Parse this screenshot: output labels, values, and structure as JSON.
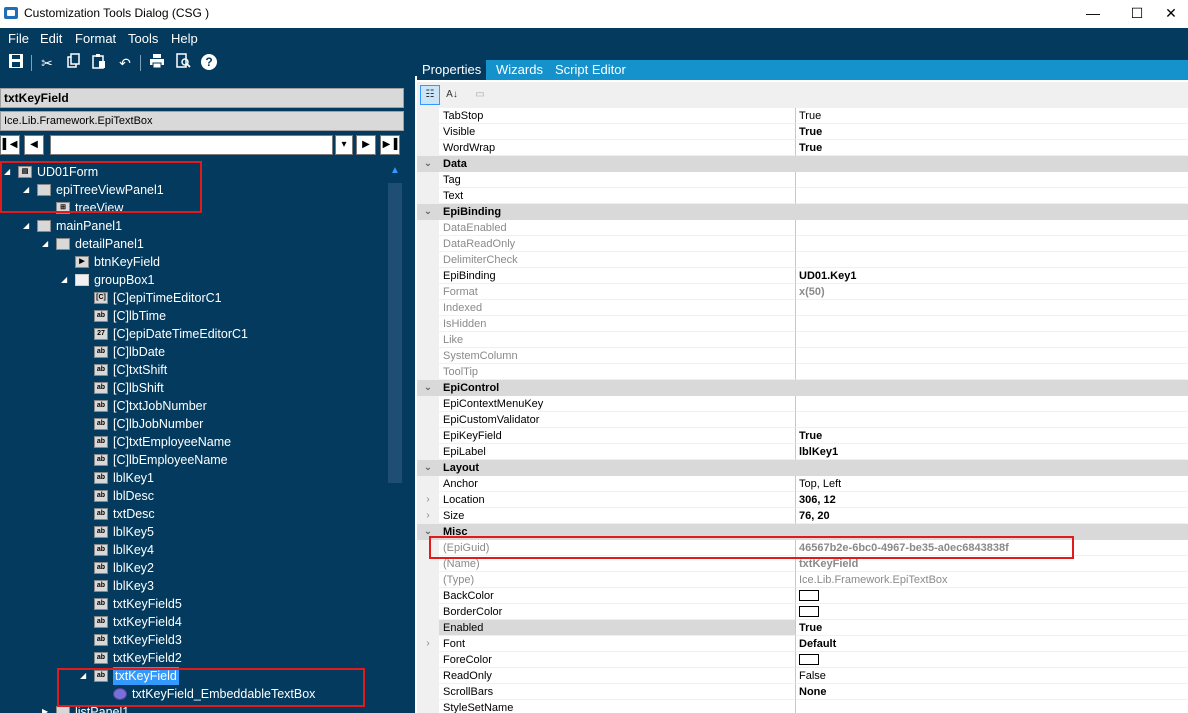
{
  "window": {
    "title": "Customization Tools Dialog  (CSG )",
    "minimize": "—",
    "maximize": "☐",
    "close": "✕"
  },
  "menu": [
    "File",
    "Edit",
    "Format",
    "Tools",
    "Help"
  ],
  "toolbar_icons": [
    "save-icon",
    "cut-icon",
    "copy-icon",
    "paste-icon",
    "undo-icon",
    "print-icon",
    "print-preview-icon",
    "help-icon"
  ],
  "left": {
    "selected_name": "txtKeyField",
    "selected_type": "Ice.Lib.Framework.EpiTextBox"
  },
  "tree": [
    {
      "label": "UD01Form",
      "level": 0,
      "expand": "◢",
      "icon": "form"
    },
    {
      "label": "epiTreeViewPanel1",
      "level": 1,
      "expand": "◢",
      "icon": "panel"
    },
    {
      "label": "treeView",
      "level": 2,
      "expand": "",
      "icon": "treeview"
    },
    {
      "label": "mainPanel1",
      "level": 1,
      "expand": "◢",
      "icon": "panel"
    },
    {
      "label": "detailPanel1",
      "level": 2,
      "expand": "◢",
      "icon": "panel"
    },
    {
      "label": "btnKeyField",
      "level": 3,
      "expand": "",
      "icon": "button"
    },
    {
      "label": "groupBox1",
      "level": 3,
      "expand": "◢",
      "icon": "folder"
    },
    {
      "label": "[C]epiTimeEditorC1",
      "level": 4,
      "expand": "",
      "icon": "time"
    },
    {
      "label": "[C]lbTime",
      "level": 4,
      "expand": "",
      "icon": "ab"
    },
    {
      "label": "[C]epiDateTimeEditorC1",
      "level": 4,
      "expand": "",
      "icon": "date"
    },
    {
      "label": "[C]lbDate",
      "level": 4,
      "expand": "",
      "icon": "ab"
    },
    {
      "label": "[C]txtShift",
      "level": 4,
      "expand": "",
      "icon": "txt"
    },
    {
      "label": "[C]lbShift",
      "level": 4,
      "expand": "",
      "icon": "ab"
    },
    {
      "label": "[C]txtJobNumber",
      "level": 4,
      "expand": "",
      "icon": "txt"
    },
    {
      "label": "[C]lbJobNumber",
      "level": 4,
      "expand": "",
      "icon": "ab"
    },
    {
      "label": "[C]txtEmployeeName",
      "level": 4,
      "expand": "",
      "icon": "txt"
    },
    {
      "label": "[C]lbEmployeeName",
      "level": 4,
      "expand": "",
      "icon": "ab"
    },
    {
      "label": "lblKey1",
      "level": 4,
      "expand": "",
      "icon": "ab"
    },
    {
      "label": "lblDesc",
      "level": 4,
      "expand": "",
      "icon": "ab"
    },
    {
      "label": "txtDesc",
      "level": 4,
      "expand": "",
      "icon": "txt"
    },
    {
      "label": "lblKey5",
      "level": 4,
      "expand": "",
      "icon": "ab"
    },
    {
      "label": "lblKey4",
      "level": 4,
      "expand": "",
      "icon": "ab"
    },
    {
      "label": "lblKey2",
      "level": 4,
      "expand": "",
      "icon": "ab"
    },
    {
      "label": "lblKey3",
      "level": 4,
      "expand": "",
      "icon": "ab"
    },
    {
      "label": "txtKeyField5",
      "level": 4,
      "expand": "",
      "icon": "txt"
    },
    {
      "label": "txtKeyField4",
      "level": 4,
      "expand": "",
      "icon": "txt"
    },
    {
      "label": "txtKeyField3",
      "level": 4,
      "expand": "",
      "icon": "txt"
    },
    {
      "label": "txtKeyField2",
      "level": 4,
      "expand": "",
      "icon": "txt"
    },
    {
      "label": "txtKeyField",
      "level": 4,
      "expand": "◢",
      "icon": "txt",
      "selected": true
    },
    {
      "label": "txtKeyField_EmbeddableTextBox",
      "level": 5,
      "expand": "",
      "icon": "gear"
    },
    {
      "label": "listPanel1",
      "level": 2,
      "expand": "▶",
      "icon": "panel"
    }
  ],
  "tabs": [
    "Properties",
    "Wizards",
    "Script Editor"
  ],
  "properties": [
    {
      "kind": "prop",
      "name": "TabStop",
      "value": "True"
    },
    {
      "kind": "prop",
      "name": "Visible",
      "value": "True",
      "bold": true
    },
    {
      "kind": "prop",
      "name": "WordWrap",
      "value": "True",
      "bold": true
    },
    {
      "kind": "cat",
      "name": "Data"
    },
    {
      "kind": "prop",
      "name": "Tag",
      "value": ""
    },
    {
      "kind": "prop",
      "name": "Text",
      "value": ""
    },
    {
      "kind": "cat",
      "name": "EpiBinding"
    },
    {
      "kind": "prop",
      "name": "DataEnabled",
      "value": "",
      "dim": true
    },
    {
      "kind": "prop",
      "name": "DataReadOnly",
      "value": "",
      "dim": true
    },
    {
      "kind": "prop",
      "name": "DelimiterCheck",
      "value": "",
      "dim": true
    },
    {
      "kind": "prop",
      "name": "EpiBinding",
      "value": "UD01.Key1",
      "bold": true
    },
    {
      "kind": "prop",
      "name": "Format",
      "value": "x(50)",
      "dim": true,
      "bold": true
    },
    {
      "kind": "prop",
      "name": "Indexed",
      "value": "",
      "dim": true
    },
    {
      "kind": "prop",
      "name": "IsHidden",
      "value": "",
      "dim": true
    },
    {
      "kind": "prop",
      "name": "Like",
      "value": "",
      "dim": true
    },
    {
      "kind": "prop",
      "name": "SystemColumn",
      "value": "",
      "dim": true
    },
    {
      "kind": "prop",
      "name": "ToolTip",
      "value": "",
      "dim": true
    },
    {
      "kind": "cat",
      "name": "EpiControl"
    },
    {
      "kind": "prop",
      "name": "EpiContextMenuKey",
      "value": ""
    },
    {
      "kind": "prop",
      "name": "EpiCustomValidator",
      "value": ""
    },
    {
      "kind": "prop",
      "name": "EpiKeyField",
      "value": "True",
      "bold": true
    },
    {
      "kind": "prop",
      "name": "EpiLabel",
      "value": "lblKey1",
      "bold": true
    },
    {
      "kind": "cat",
      "name": "Layout"
    },
    {
      "kind": "prop",
      "name": "Anchor",
      "value": "Top, Left"
    },
    {
      "kind": "prop",
      "name": "Location",
      "value": "306, 12",
      "bold": true,
      "expand": "›"
    },
    {
      "kind": "prop",
      "name": "Size",
      "value": "76, 20",
      "bold": true,
      "expand": "›"
    },
    {
      "kind": "cat",
      "name": "Misc"
    },
    {
      "kind": "prop",
      "name": "(EpiGuid)",
      "value": "46567b2e-6bc0-4967-be35-a0ec6843838f",
      "dim": true,
      "bold": true
    },
    {
      "kind": "prop",
      "name": "(Name)",
      "value": "txtKeyField",
      "dim": true,
      "bold": true
    },
    {
      "kind": "prop",
      "name": "(Type)",
      "value": "Ice.Lib.Framework.EpiTextBox",
      "dim": true
    },
    {
      "kind": "prop",
      "name": "BackColor",
      "value": "",
      "swatch": true
    },
    {
      "kind": "prop",
      "name": "BorderColor",
      "value": "",
      "swatch": true
    },
    {
      "kind": "prop",
      "name": "Enabled",
      "value": "True",
      "bold": true,
      "hl": true
    },
    {
      "kind": "prop",
      "name": "Font",
      "value": "Default",
      "bold": true,
      "expand": "›"
    },
    {
      "kind": "prop",
      "name": "ForeColor",
      "value": "",
      "swatch": true
    },
    {
      "kind": "prop",
      "name": "ReadOnly",
      "value": "False"
    },
    {
      "kind": "prop",
      "name": "ScrollBars",
      "value": "None",
      "bold": true
    },
    {
      "kind": "prop",
      "name": "StyleSetName",
      "value": ""
    }
  ],
  "colors": {
    "dark_panel": "#033a5e",
    "tab_bar": "#1591cc",
    "selection": "#3399ff",
    "annotation": "#e01b1b"
  }
}
